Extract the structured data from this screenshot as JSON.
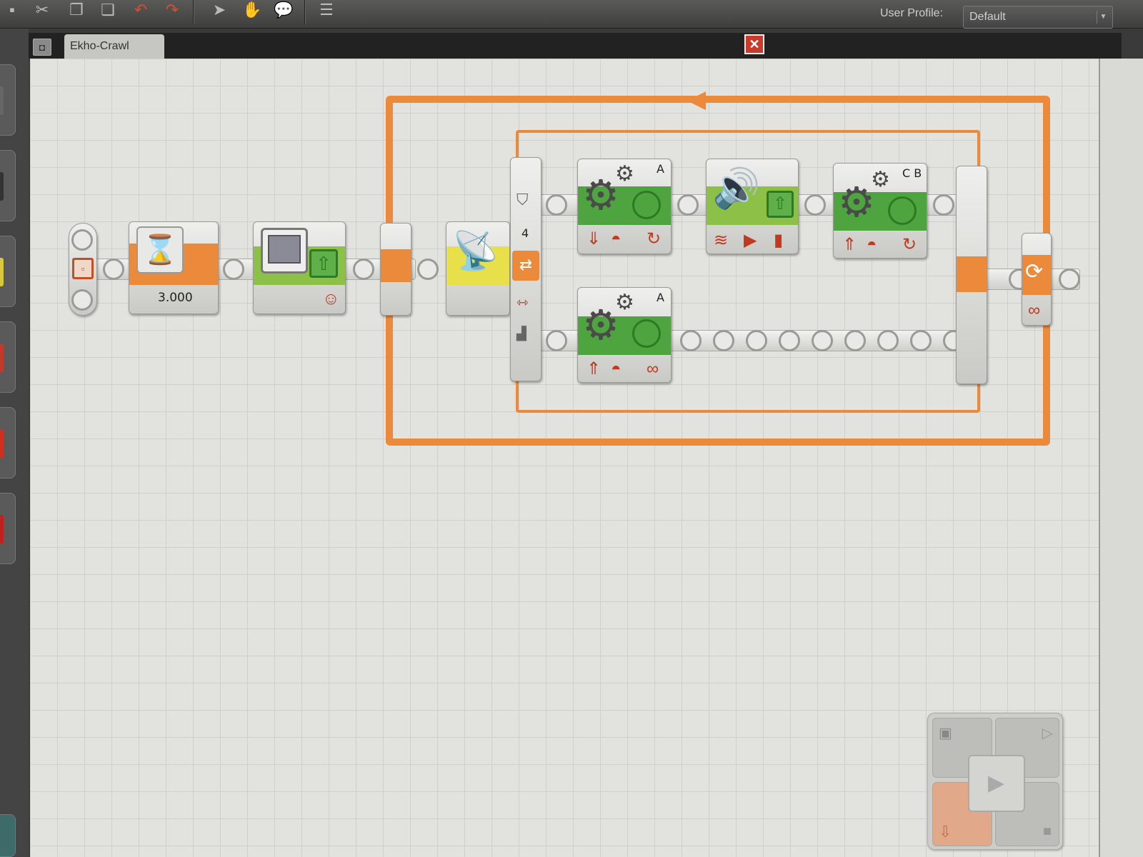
{
  "toolbar": {
    "icons": [
      "cut-icon",
      "copy-icon",
      "paste-icon",
      "undo-icon",
      "redo-icon",
      "pointer-icon",
      "pan-icon",
      "comment-icon",
      "custom-palette-icon"
    ],
    "user_profile_label": "User Profile:",
    "user_profile_value": "Default"
  },
  "tab": {
    "title": "Ekho-Crawl"
  },
  "blocks": {
    "wait": {
      "value": "3.000"
    },
    "switch": {
      "case_label": "4"
    },
    "motor_a_top": {
      "port": "A"
    },
    "motor_cb": {
      "port": "C B"
    },
    "motor_a_bottom": {
      "port": "A"
    }
  },
  "colors": {
    "loop_orange": "#ec8a3b",
    "action_green": "#4ea43e",
    "sensor_yellow": "#e8e04a",
    "icon_red": "#c03a20"
  }
}
